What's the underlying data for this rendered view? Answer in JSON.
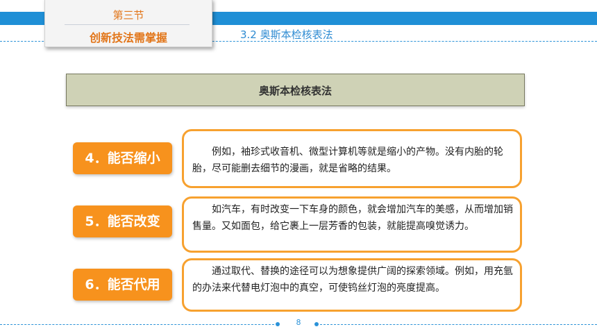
{
  "header": {
    "section_number": "第三节",
    "section_title": "创新技法需掌握",
    "subtitle": "3.2  奥斯本检核表法"
  },
  "main": {
    "title": "奥斯本检核表法",
    "items": [
      {
        "label": "4．能否缩小",
        "text": "例如，袖珍式收音机、微型计算机等就是缩小的产物。没有内胎的轮胎，尽可能删去细节的漫画，就是省略的结果。"
      },
      {
        "label": "5．能否改变",
        "text": "如汽车，有时改变一下车身的颜色，就会增加汽车的美感，从而增加销售量。又如面包，给它裹上一层芳香的包装，就能提高嗅觉诱力。"
      },
      {
        "label": "6．能否代用",
        "text": "通过取代、替换的途径可以为想象提供广阔的探索领域。例如，用充氩的办法来代替电灯泡中的真空，可使钨丝灯泡的亮度提高。"
      }
    ]
  },
  "footer": {
    "page_number": "8"
  }
}
